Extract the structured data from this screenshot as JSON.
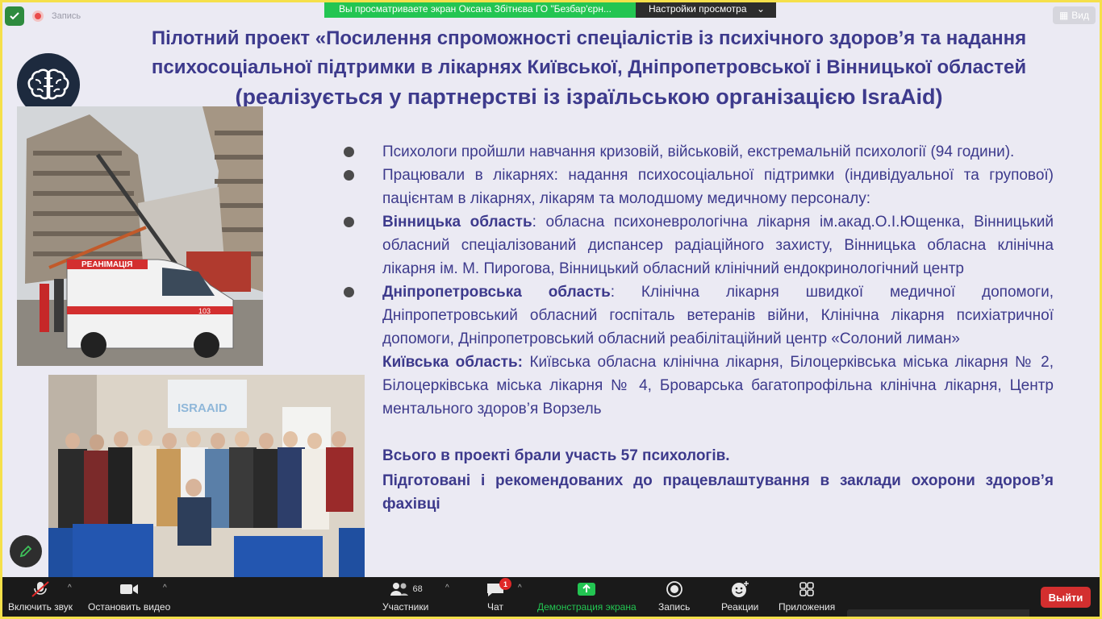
{
  "recording": {
    "label": "Запись"
  },
  "banner": {
    "sharing_text": "Вы просматриваете экран Оксана Збітнєва ГО \"Безбар'єрн...",
    "view_settings": "Настройки просмотра"
  },
  "view_button": {
    "label": "Вид"
  },
  "slide": {
    "title_line1": "Пілотний проект «Посилення спроможності спеціалістів із психічного здоров’я та надання",
    "title_line2": "психосоціальної підтримки в лікарнях Київської, Дніпропетровської і Вінницької областей",
    "title_line3": "(реалізується у партнерстві із ізраїльською організацією IsraAid)",
    "items": [
      {
        "text": "Психологи пройшли навчання кризовій, військовій, екстремальній психології (94 години)."
      },
      {
        "text": "Працювали в лікарнях: надання психосоціальної підтримки (індивідуальної та групової) пацієнтам в лікарнях, лікарям та молодшому медичному персоналу:"
      },
      {
        "bold": "Вінницька область",
        "text": ": обласна психоневрологічна лікарня ім.акад.О.І.Ющенка, Вінницький обласний спеціалізований диспансер радіаційного захисту, Вінницька обласна клінічна лікарня ім. М. Пирогова, Вінницький обласний клінічний ендокринологічний центр"
      },
      {
        "bold": "Дніпропетровська область",
        "text": ":  Клінічна лікарня швидкої медичної допомоги, Дніпропетровський обласний госпіталь ветеранів війни, Клінічна лікарня психіатричної допомоги, Дніпропетровський обласний реабілітаційний центр «Солоний лиман»"
      },
      {
        "bold": "Київська область:",
        "text": " Київська обласна клінічна лікарня, Білоцерківська міська лікарня № 2, Білоцерківська міська лікарня № 4, Броварська багатопрофільна клінічна лікарня, Центр ментального здоров’я Ворзель"
      }
    ],
    "total": "Всього в проекті брали участь 57 психологів.",
    "prepared": "Підготовані і рекомендованих до працевлаштування в заклади охорони здоров’я фахівці",
    "ambulance_text": "РЕАНІМАЦІЯ",
    "ambulance_number": "103",
    "banner_logo": "ISRAAID"
  },
  "toolbar": {
    "unmute": "Включить звук",
    "stop_video": "Остановить видео",
    "participants": "Участники",
    "participants_count": "68",
    "chat": "Чат",
    "chat_badge": "1",
    "share": "Демонстрация экрана",
    "record": "Запись",
    "reactions": "Реакции",
    "apps": "Приложения",
    "leave": "Выйти"
  },
  "colors": {
    "title": "#3d3a8c",
    "share_green": "#23c552",
    "leave_red": "#d32f2f",
    "frame_yellow": "#f5e04a"
  }
}
